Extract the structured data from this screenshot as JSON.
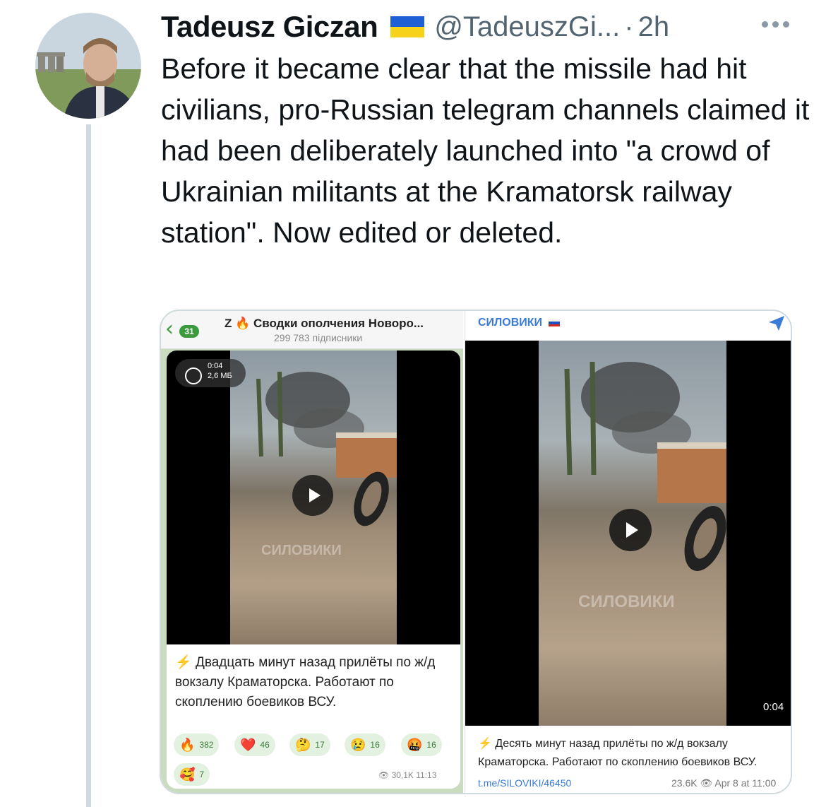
{
  "tweet": {
    "display_name": "Tadeusz Giczan",
    "handle": "@TadeuszGi...",
    "separator": "·",
    "time": "2h",
    "text": "Before it became clear that the missile had hit civilians, pro-Russian telegram channels claimed it had been deliberately launched into \"a crowd of Ukrainian militants at the Kramatorsk railway station\". Now edited or deleted."
  },
  "left_post": {
    "unread_count": "31",
    "channel_title": "Z 🔥 Сводки ополчения Новоро...",
    "subscribers": "299 783 підписники",
    "video_duration": "0:04",
    "video_size": "2,6 МБ",
    "message_icon": "⚡",
    "message": "Двадцать минут назад прилёты по ж/д вокзалу Краматорска. Работают по скоплению боевиков ВСУ.",
    "reactions": [
      {
        "emoji": "🔥",
        "count": "382"
      },
      {
        "emoji": "❤️",
        "count": "46"
      },
      {
        "emoji": "🤔",
        "count": "17"
      },
      {
        "emoji": "😢",
        "count": "16"
      },
      {
        "emoji": "🤬",
        "count": "16"
      },
      {
        "emoji": "🥰",
        "count": "7"
      }
    ],
    "views_time": "👁 30,1K 11:13",
    "watermark": "СИЛОВИКИ"
  },
  "right_post": {
    "channel_name": "СИЛОВИКИ",
    "video_duration": "0:04",
    "message_icon": "⚡",
    "message": "Десять минут назад прилёты по ж/д вокзалу Краматорска. Работают по скоплению боевиков ВСУ.",
    "link": "t.me/SILOVIKI/46450",
    "meta": "23.6K 👁 Apr 8 at 11:00",
    "watermark": "СИЛОВИКИ"
  },
  "colors": {
    "text": "#0f1419",
    "secondary": "#536471",
    "thread_line": "#cfd9de",
    "telegram_link": "#3a7bd5",
    "telegram_green": "#3b9a3b"
  }
}
